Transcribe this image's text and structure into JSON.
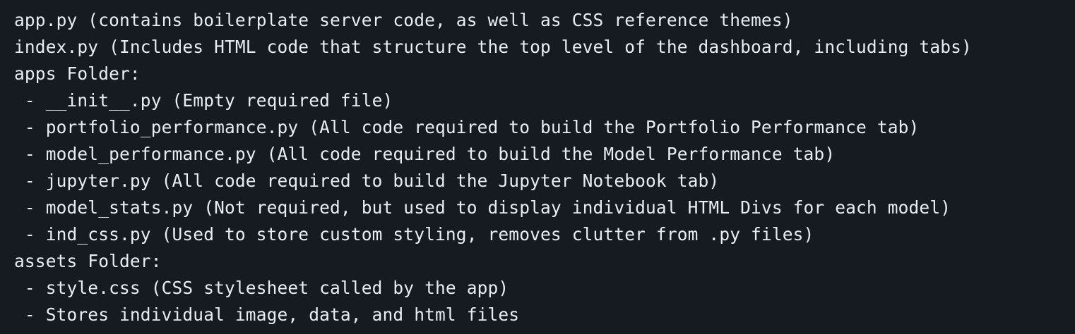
{
  "code": {
    "lines": [
      "app.py (contains boilerplate server code, as well as CSS reference themes)",
      "index.py (Includes HTML code that structure the top level of the dashboard, including tabs)",
      "apps Folder:",
      " - __init__.py (Empty required file)",
      " - portfolio_performance.py (All code required to build the Portfolio Performance tab)",
      " - model_performance.py (All code required to build the Model Performance tab)",
      " - jupyter.py (All code required to build the Jupyter Notebook tab)",
      " - model_stats.py (Not required, but used to display individual HTML Divs for each model)",
      " - ind_css.py (Used to store custom styling, removes clutter from .py files)",
      "assets Folder:",
      " - style.css (CSS stylesheet called by the app)",
      " - Stores individual image, data, and html files"
    ]
  },
  "colors": {
    "background": "#161b22",
    "text": "#e6edf3"
  }
}
